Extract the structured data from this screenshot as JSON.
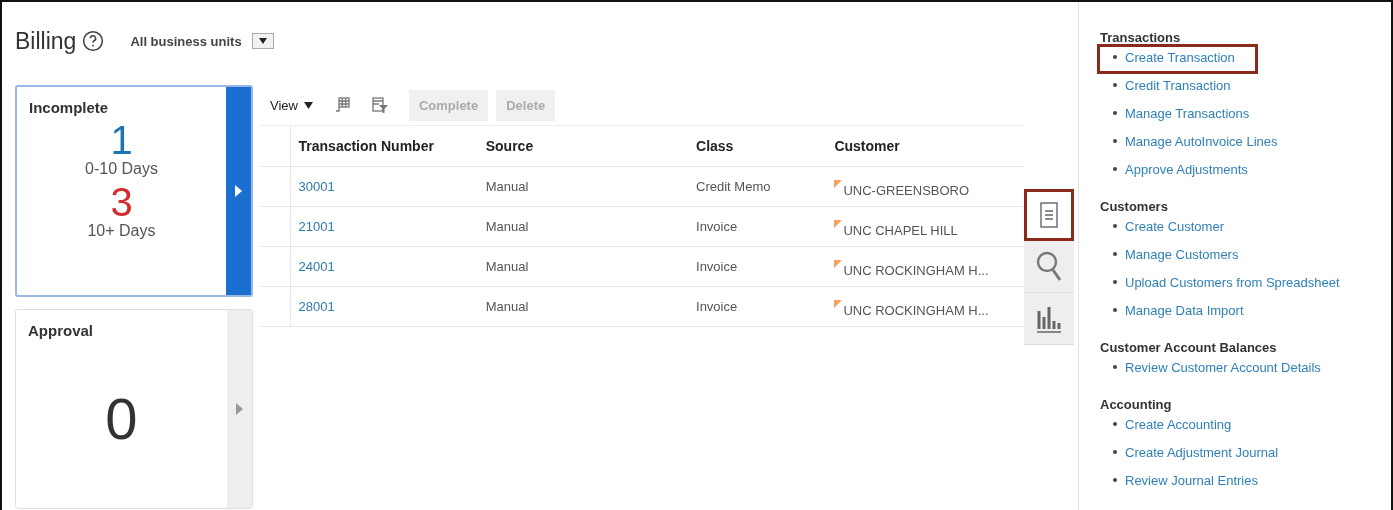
{
  "header": {
    "title": "Billing",
    "business_unit": "All business units"
  },
  "cards": [
    {
      "title": "Incomplete",
      "selected": true,
      "metrics": [
        {
          "value": "1",
          "label": "0-10 Days",
          "color": "#1f74b5"
        },
        {
          "value": "3",
          "label": "10+ Days",
          "color": "#d22b2b"
        }
      ]
    },
    {
      "title": "Approval",
      "selected": false,
      "metrics": [
        {
          "value": "0",
          "color": "#333333"
        }
      ]
    }
  ],
  "toolbar": {
    "view": "View",
    "buttons": [
      {
        "label": "Complete",
        "disabled": true
      },
      {
        "label": "Delete",
        "disabled": true
      }
    ]
  },
  "table": {
    "columns": [
      "Transaction Number",
      "Source",
      "Class",
      "Customer"
    ],
    "rows": [
      {
        "number": "30001",
        "source": "Manual",
        "class": "Credit Memo",
        "customer": "UNC-GREENSBORO"
      },
      {
        "number": "21001",
        "source": "Manual",
        "class": "Invoice",
        "customer": "UNC CHAPEL HILL"
      },
      {
        "number": "24001",
        "source": "Manual",
        "class": "Invoice",
        "customer": "UNC ROCKINGHAM H..."
      },
      {
        "number": "28001",
        "source": "Manual",
        "class": "Invoice",
        "customer": "UNC ROCKINGHAM H..."
      }
    ]
  },
  "side_tabs": [
    {
      "kind": "tasks",
      "selected": true,
      "highlighted": true
    },
    {
      "kind": "search",
      "selected": false,
      "highlighted": false
    },
    {
      "kind": "reports",
      "selected": false,
      "highlighted": false
    }
  ],
  "tasks": [
    {
      "heading": "Transactions",
      "links": [
        {
          "label": "Create Transaction",
          "highlighted": true
        },
        {
          "label": "Credit Transaction",
          "highlighted": false
        },
        {
          "label": "Manage Transactions",
          "highlighted": false
        },
        {
          "label": "Manage AutoInvoice Lines",
          "highlighted": false
        },
        {
          "label": "Approve Adjustments",
          "highlighted": false
        }
      ]
    },
    {
      "heading": "Customers",
      "links": [
        {
          "label": "Create Customer",
          "highlighted": false
        },
        {
          "label": "Manage Customers",
          "highlighted": false
        },
        {
          "label": "Upload Customers from Spreadsheet",
          "highlighted": false
        },
        {
          "label": "Manage Data Import",
          "highlighted": false
        }
      ]
    },
    {
      "heading": "Customer Account Balances",
      "links": [
        {
          "label": "Review Customer Account Details",
          "highlighted": false
        }
      ]
    },
    {
      "heading": "Accounting",
      "links": [
        {
          "label": "Create Accounting",
          "highlighted": false
        },
        {
          "label": "Create Adjustment Journal",
          "highlighted": false
        },
        {
          "label": "Review Journal Entries",
          "highlighted": false
        }
      ]
    }
  ]
}
